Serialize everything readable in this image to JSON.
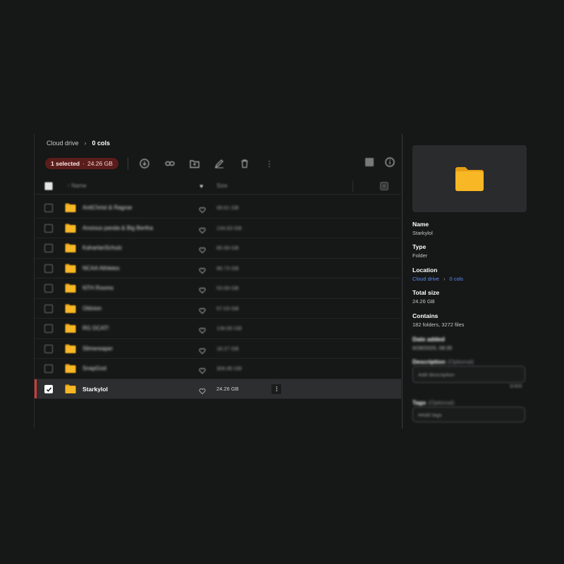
{
  "breadcrumb": {
    "root": "Cloud drive",
    "current": "0 cols"
  },
  "toolbar": {
    "selection_count": "1 selected",
    "selection_separator": "·",
    "selection_size": "24.26 GB",
    "more_label": "⋮"
  },
  "table": {
    "header_name": "Name",
    "header_size": "Size",
    "rows": [
      {
        "name": "AntiChrist & Ragnar",
        "size": "49.61 GB"
      },
      {
        "name": "Anxious panda & Big Bertha",
        "size": "134.63 GB"
      },
      {
        "name": "KaharlanSchulz",
        "size": "85.99 GB"
      },
      {
        "name": "NCAA Athletes",
        "size": "96.73 GB"
      },
      {
        "name": "NTH Rooms",
        "size": "53.69 GB"
      },
      {
        "name": "Oldvion",
        "size": "57.03 GB"
      },
      {
        "name": "RG DCAT!",
        "size": "136.65 GB"
      },
      {
        "name": "Slimereaper",
        "size": "18.27 GB"
      },
      {
        "name": "SnapGod",
        "size": "306.85 GB"
      },
      {
        "name": "Starkylol",
        "size": "24.26 GB"
      }
    ]
  },
  "details": {
    "name_label": "Name",
    "name_value": "Starkylol",
    "type_label": "Type",
    "type_value": "Folder",
    "location_label": "Location",
    "location_root": "Cloud drive",
    "location_current": "0 cols",
    "total_size_label": "Total size",
    "total_size_value": "24.26 GB",
    "contains_label": "Contains",
    "contains_value": "182 folders, 3272 files",
    "date_added_label": "Date added",
    "date_added_value": "6/28/2025, 08:35",
    "description_label": "Description",
    "description_optional": "(Optional)",
    "description_placeholder": "Add description",
    "description_counter": "0/300",
    "tags_label": "Tags",
    "tags_optional": "(Optional)",
    "tags_placeholder": "#Add tags"
  },
  "colors": {
    "background": "#161717",
    "selection_pill": "#5b1d1b",
    "selected_row_accent": "#d63b36",
    "folder": "#f5b323",
    "link": "#5c8df0"
  }
}
